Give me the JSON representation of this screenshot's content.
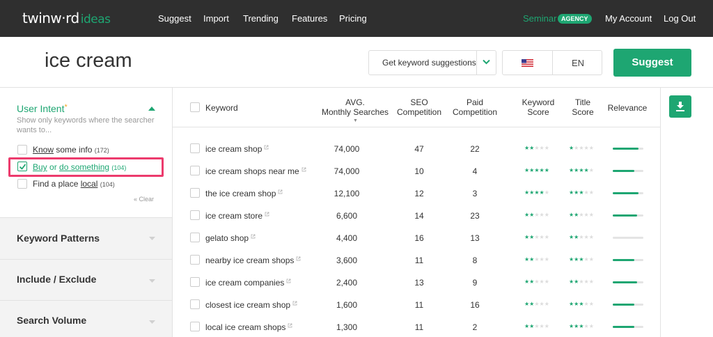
{
  "nav": {
    "logo_main": "twinw·rd",
    "logo_sub": "ideas",
    "links": [
      "Suggest",
      "Import",
      "Trending",
      "Features",
      "Pricing"
    ],
    "seminar": "Seminar",
    "agency_badge": "AGENCY",
    "my_account": "My Account",
    "log_out": "Log Out"
  },
  "search": {
    "query": "ice cream",
    "mode_label": "Get keyword suggestions",
    "language": "EN",
    "suggest_label": "Suggest"
  },
  "sidebar": {
    "intent_title": "User Intent",
    "intent_asterisk": "*",
    "intent_desc": "Show only keywords where the searcher wants to...",
    "options": [
      {
        "w1": "Know",
        "mid": " some info ",
        "w2": "",
        "count": "(172)",
        "checked": false
      },
      {
        "w1": "Buy",
        "mid": " or ",
        "w2": "do something",
        "count": "(104)",
        "checked": true
      },
      {
        "w1": "Find a place ",
        "mid": "",
        "w2": "local",
        "count": "(104)",
        "checked": false
      }
    ],
    "clear_label": "« Clear",
    "sections": [
      "Keyword Patterns",
      "Include / Exclude",
      "Search Volume"
    ]
  },
  "table": {
    "headers": {
      "keyword": "Keyword",
      "avg_1": "AVG.",
      "avg_2": "Monthly Searches",
      "seo_1": "SEO",
      "seo_2": "Competition",
      "paid_1": "Paid",
      "paid_2": "Competition",
      "ks_1": "Keyword",
      "ks_2": "Score",
      "ts_1": "Title",
      "ts_2": "Score",
      "relevance": "Relevance"
    },
    "sort_indicator": "▼",
    "rows": [
      {
        "keyword": "ice cream shop",
        "searches": "74,000",
        "seo": "47",
        "paid": "22",
        "kw_score": 2,
        "title_score": 1,
        "relevance": 0.85
      },
      {
        "keyword": "ice cream shops near me",
        "searches": "74,000",
        "seo": "10",
        "paid": "4",
        "kw_score": 5,
        "title_score": 4,
        "relevance": 0.7
      },
      {
        "keyword": "the ice cream shop",
        "searches": "12,100",
        "seo": "12",
        "paid": "3",
        "kw_score": 4,
        "title_score": 3,
        "relevance": 0.85
      },
      {
        "keyword": "ice cream store",
        "searches": "6,600",
        "seo": "14",
        "paid": "23",
        "kw_score": 2,
        "title_score": 2,
        "relevance": 0.8
      },
      {
        "keyword": "gelato shop",
        "searches": "4,400",
        "seo": "16",
        "paid": "13",
        "kw_score": 2,
        "title_score": 2,
        "relevance": 0
      },
      {
        "keyword": "nearby ice cream shops",
        "searches": "3,600",
        "seo": "11",
        "paid": "8",
        "kw_score": 2,
        "title_score": 3,
        "relevance": 0.7
      },
      {
        "keyword": "ice cream companies",
        "searches": "2,400",
        "seo": "13",
        "paid": "9",
        "kw_score": 2,
        "title_score": 2,
        "relevance": 0.8
      },
      {
        "keyword": "closest ice cream shop",
        "searches": "1,600",
        "seo": "11",
        "paid": "16",
        "kw_score": 2,
        "title_score": 3,
        "relevance": 0.7
      },
      {
        "keyword": "local ice cream shops",
        "searches": "1,300",
        "seo": "11",
        "paid": "2",
        "kw_score": 2,
        "title_score": 3,
        "relevance": 0.7
      }
    ]
  },
  "icons": {
    "download": "download-icon",
    "external": "external-link-icon",
    "flag": "us-flag-icon"
  },
  "colors": {
    "accent": "#1ea672",
    "highlight": "#ec3b6d",
    "nav_bg": "#2f2f2f"
  }
}
